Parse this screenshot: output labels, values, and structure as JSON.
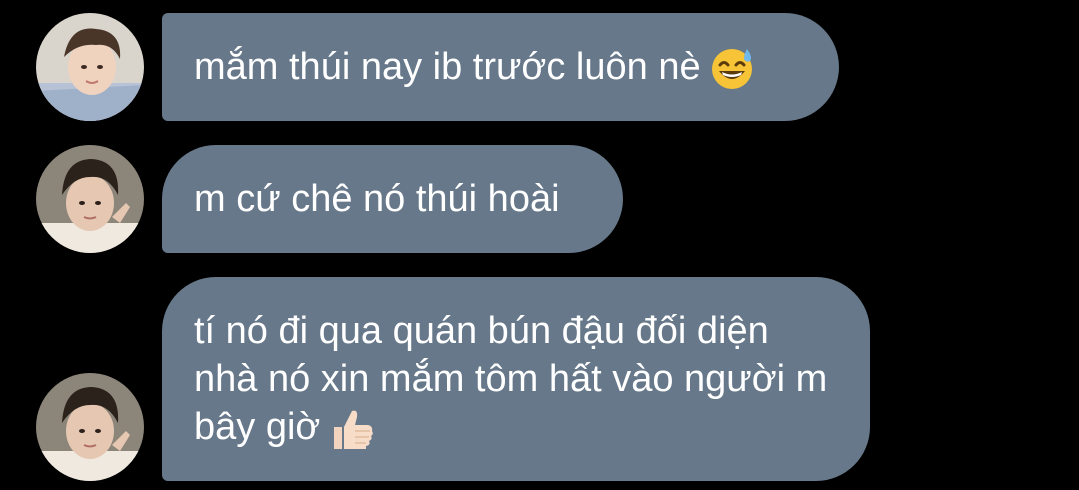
{
  "messages": [
    {
      "text": "mắm thúi nay ib trước luôn nè",
      "emoji": "grinning-sweat-emoji"
    },
    {
      "text": "m cứ chê nó thúi hoài"
    },
    {
      "text": "tí nó đi qua quán bún đậu đối diện nhà nó xin mắm tôm hất vào người m bây giờ",
      "emoji": "thumbs-up-emoji"
    }
  ],
  "colors": {
    "background": "#000000",
    "bubble": "#66788a",
    "text": "#ffffff"
  }
}
